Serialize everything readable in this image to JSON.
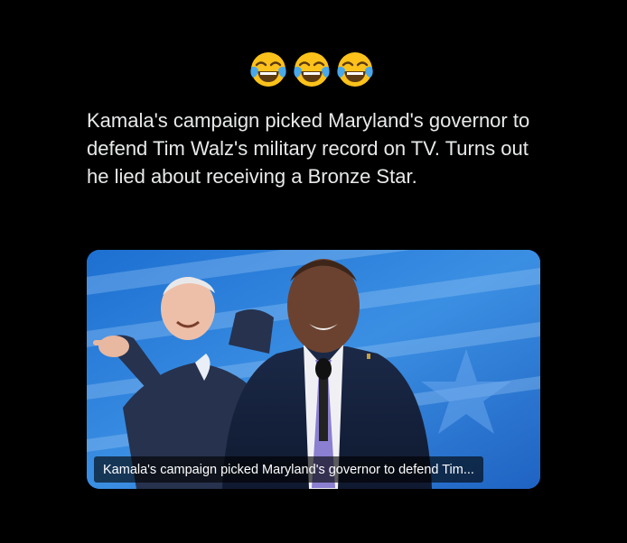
{
  "header": {
    "emojis": [
      "face-with-tears-of-joy",
      "face-with-tears-of-joy",
      "face-with-tears-of-joy"
    ]
  },
  "post": {
    "text": "Kamala's campaign picked Maryland's governor to defend Tim Walz's military record on TV. Turns out he lied about receiving a Bronze Star."
  },
  "media": {
    "caption": "Kamala's campaign picked Maryland's governor to defend Tim..."
  },
  "colors": {
    "background": "#000000",
    "text": "#e7e9ea",
    "stage_blue": "#2a78d0"
  }
}
